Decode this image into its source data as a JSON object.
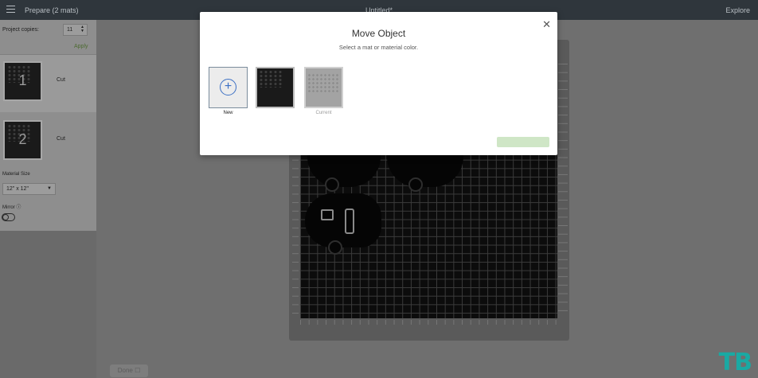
{
  "topbar": {
    "project_title": "Prepare (2 mats)",
    "doc_title": "Untitled*",
    "explore": "Explore",
    "menu_icon": "hamburger-menu-icon"
  },
  "left_panel": {
    "copies_label": "Project copies:",
    "copies_value": "11",
    "apply_label": "Apply",
    "mats": [
      {
        "number": "1",
        "label": "Cut",
        "selected": true
      },
      {
        "number": "2",
        "label": "Cut",
        "selected": false
      }
    ],
    "material_size_label": "Material Size",
    "material_size_value": "12\" x 12\"",
    "mirror_label": "Mirror ⓘ",
    "mirror_on": false
  },
  "canvas": {
    "done_button_label": "Done ☐"
  },
  "modal": {
    "title": "Move Object",
    "subtitle": "Select a mat or material color.",
    "close_icon": "close-icon",
    "options": [
      {
        "label": "New",
        "icon": "plus-circle-icon"
      },
      {
        "label": ""
      },
      {
        "label": "Current"
      }
    ],
    "confirm_button_label": ""
  },
  "watermark": "TB",
  "colors": {
    "topbar": "#2f363c",
    "accent_green": "#4d6b32",
    "plus_blue": "#3b6fc4",
    "watermark_teal": "#1aa9a3",
    "disabled_button": "#cfe6c6"
  }
}
